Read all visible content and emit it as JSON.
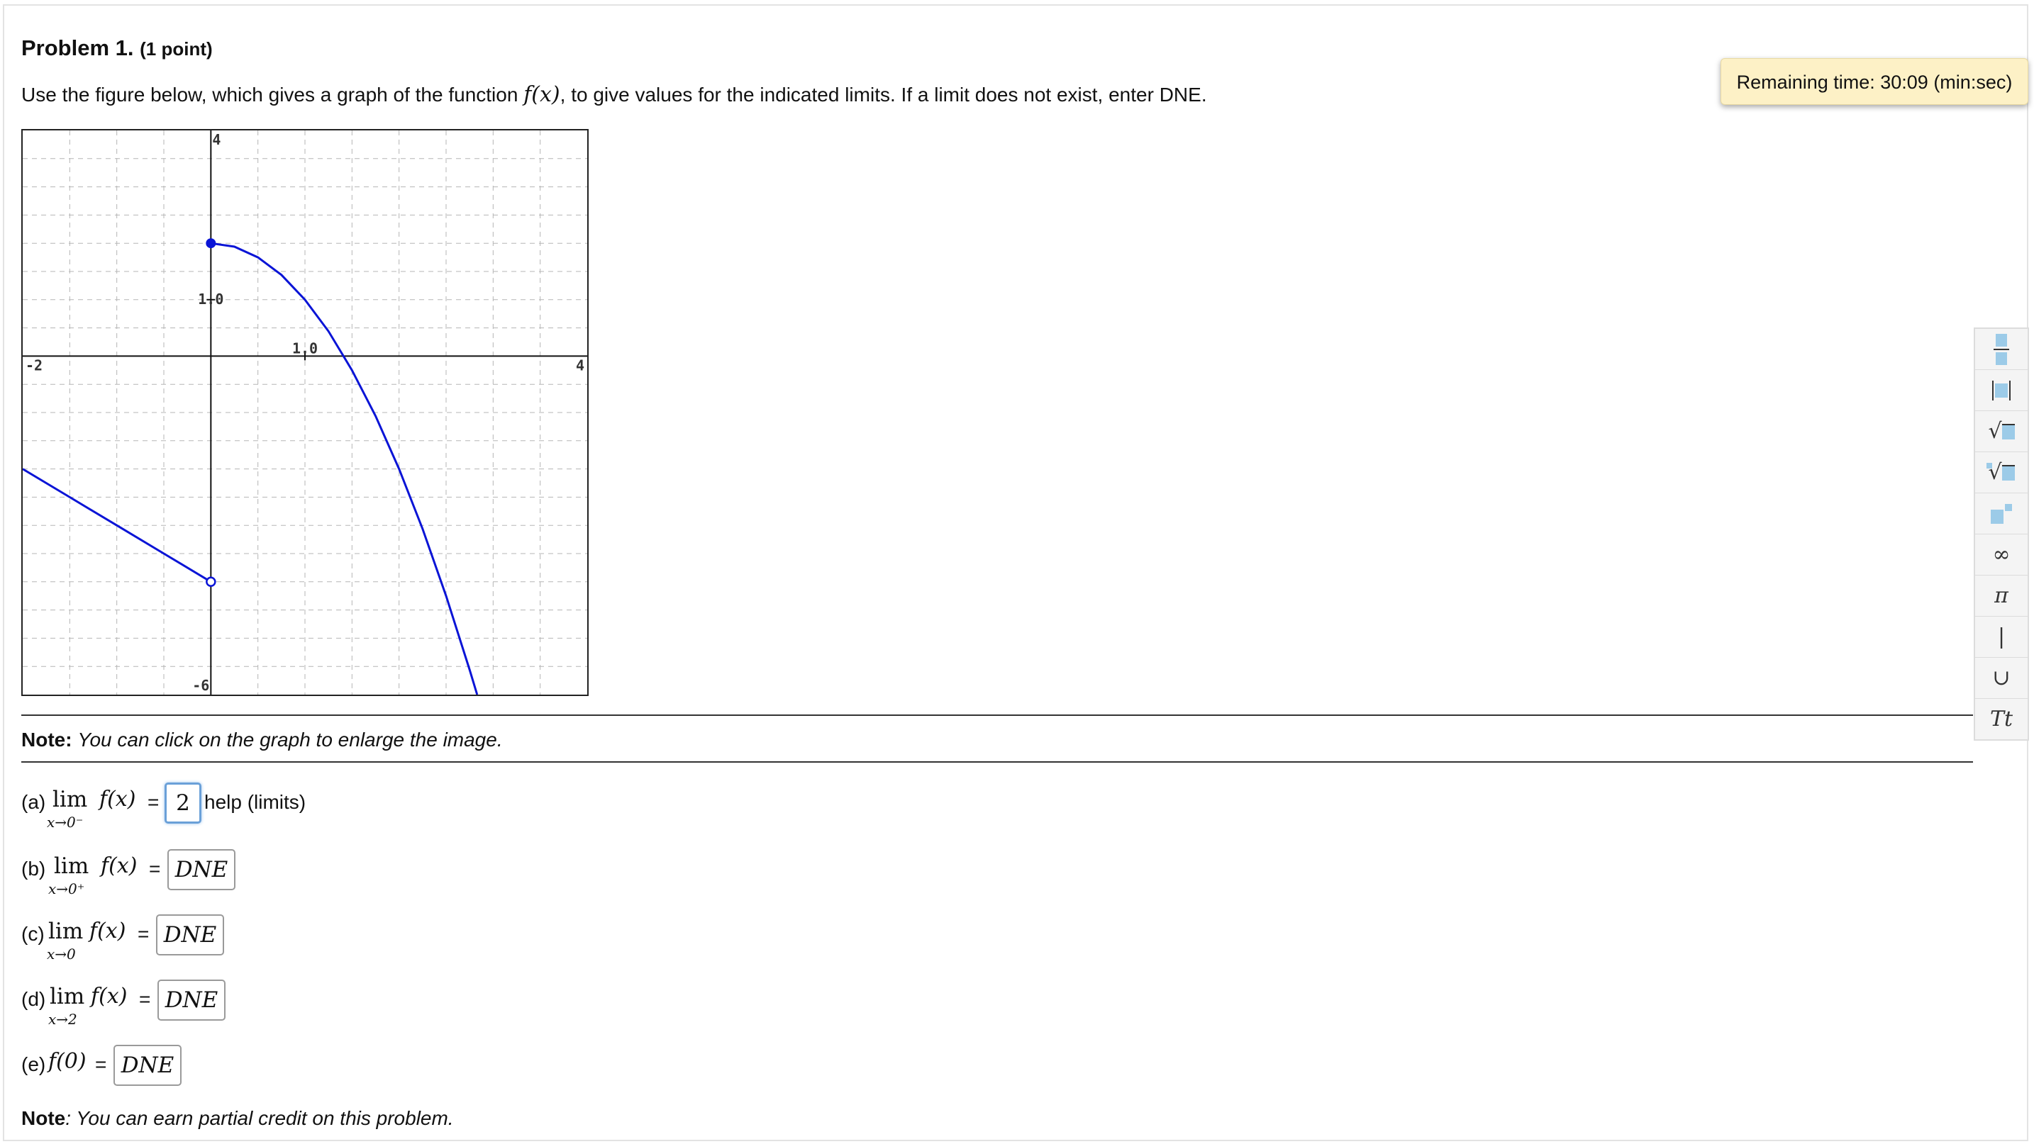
{
  "problem": {
    "title": "Problem 1.",
    "points": "(1 point)",
    "instructions_before": "Use the figure below, which gives a graph of the function ",
    "function_name": "f(x)",
    "instructions_after": ", to give values for the indicated limits. If a limit does not exist, enter DNE."
  },
  "timer": "Remaining time: 30:09 (min:sec)",
  "graph": {
    "x_min_label": "-2",
    "x_max_label": "4",
    "y_max_label": "4",
    "y_min_label": "-6",
    "x_tick_label": "1.0",
    "y_tick_label": "1.0",
    "xlim": [
      -2,
      4
    ],
    "ylim": [
      -6,
      4
    ],
    "curve_color": "#0a14d6",
    "left_piece": {
      "points": [
        [
          -2,
          -2
        ],
        [
          -1.5,
          -2.5
        ],
        [
          -1,
          -3
        ],
        [
          -0.5,
          -3.5
        ],
        [
          0,
          -4
        ]
      ],
      "endpoint_at_0": "open"
    },
    "right_piece": {
      "points": [
        [
          0,
          2
        ],
        [
          0.25,
          1.94
        ],
        [
          0.5,
          1.75
        ],
        [
          0.75,
          1.44
        ],
        [
          1,
          1
        ],
        [
          1.25,
          0.44
        ],
        [
          1.5,
          -0.25
        ],
        [
          1.75,
          -1.06
        ],
        [
          2,
          -2
        ],
        [
          2.25,
          -3.06
        ],
        [
          2.5,
          -4.25
        ],
        [
          2.75,
          -5.56
        ],
        [
          2.83,
          -6
        ]
      ],
      "endpoint_at_0": "closed"
    }
  },
  "notes": {
    "graph_note_bold": "Note:",
    "graph_note_text": "You can click on the graph to enlarge the image.",
    "credit_note_bold": "Note",
    "credit_note_text": ": You can earn partial credit on this problem."
  },
  "questions": [
    {
      "label": "(a)",
      "lim": "lim",
      "sub": "x→0⁻",
      "expr": "f(x)",
      "eq": "=",
      "answer": "2",
      "help": "help (limits)"
    },
    {
      "label": "(b)",
      "lim": "lim",
      "sub": "x→0⁺",
      "expr": "f(x)",
      "eq": "=",
      "answer": "DNE"
    },
    {
      "label": "(c)",
      "lim": "lim",
      "sub": "x→0",
      "expr": "f(x)",
      "eq": "=",
      "answer": "DNE"
    },
    {
      "label": "(d)",
      "lim": "lim",
      "sub": "x→2",
      "expr": "f(x)",
      "eq": "=",
      "answer": "DNE"
    },
    {
      "label": "(e)",
      "expr": "f(0)",
      "eq": "=",
      "answer": "DNE"
    }
  ],
  "toolbar": {
    "items": [
      "fraction-icon",
      "absolute-value-icon",
      "square-root-icon",
      "nth-root-icon",
      "exponent-icon",
      "infinity-icon",
      "pi-icon",
      "such-that-icon",
      "union-icon",
      "text-mode-icon"
    ],
    "infinity": "∞",
    "pi": "π",
    "such_that": "|",
    "union": "∪",
    "text_mode": "Tt"
  }
}
